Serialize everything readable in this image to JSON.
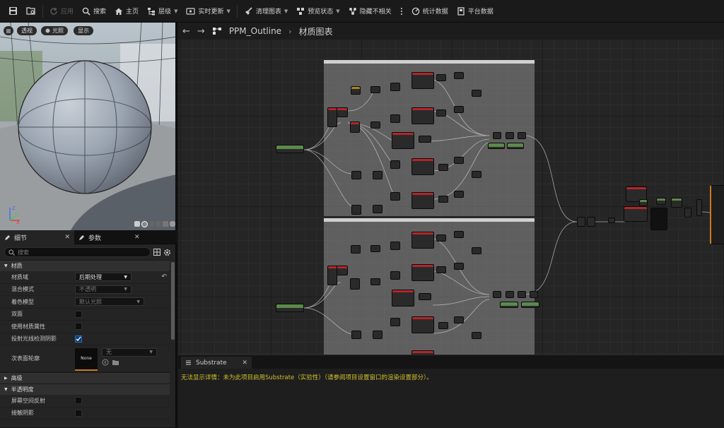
{
  "toolbar": {
    "items": [
      {
        "label": "应用",
        "icon": "apply-icon",
        "disabled": true
      },
      {
        "label": "搜索",
        "icon": "search-icon"
      },
      {
        "label": "主页",
        "icon": "home-icon"
      },
      {
        "label": "层级",
        "icon": "hierarchy-icon",
        "dropdown": true
      },
      {
        "label": "实时更新",
        "icon": "live-update-icon",
        "dropdown": true
      },
      {
        "label": "清理图表",
        "icon": "clean-graph-icon",
        "dropdown": true
      },
      {
        "label": "预览状态",
        "icon": "preview-state-icon",
        "dropdown": true
      },
      {
        "label": "隐藏不相关",
        "icon": "hide-unrelated-icon"
      },
      {
        "label": "统计数据",
        "icon": "stats-icon"
      },
      {
        "label": "平台数据",
        "icon": "platform-stats-icon"
      }
    ]
  },
  "viewport": {
    "buttons": [
      "透视",
      "光照",
      "显示"
    ],
    "axis": {
      "x": "X",
      "y": "Y",
      "z": "Z"
    }
  },
  "details_panel": {
    "tabs": [
      "细节",
      "参数"
    ],
    "search_placeholder": "搜索",
    "categories": {
      "material": "材质",
      "advanced": "高级",
      "translucency": "半透明度"
    },
    "rows": {
      "material_domain": {
        "label": "材质域",
        "value": "后期处理"
      },
      "blend_mode": {
        "label": "混合模式",
        "value": "不透明"
      },
      "shading_model": {
        "label": "着色模型",
        "value": "默认光照"
      },
      "two_sided": {
        "label": "双面",
        "checked": false
      },
      "use_material_attributes": {
        "label": "使用材质属性",
        "checked": false
      },
      "cast_ray_traced_shadows": {
        "label": "投射光线检测阴影",
        "checked": true
      },
      "subsurface_profile": {
        "label": "次表面轮廓",
        "thumb": "None",
        "value": "无"
      },
      "screen_space_reflections": {
        "label": "屏幕空间反射",
        "checked": false
      },
      "contact_shadows": {
        "label": "接触阴影",
        "checked": false
      }
    }
  },
  "graph": {
    "breadcrumb": {
      "asset": "PPM_Outline",
      "page": "材质图表"
    }
  },
  "substrate_panel": {
    "tab": "Substrate",
    "message": "无法显示详情：未为此项目启用Substrate（实验性）（请参阅项目设置窗口的渲染设置部分）。"
  },
  "colors": {
    "node_header_red": "#b3262b",
    "node_header_green": "#5b8a4a",
    "warning_text": "#d4c12a",
    "checkbox_on": "#2b6fb5"
  }
}
